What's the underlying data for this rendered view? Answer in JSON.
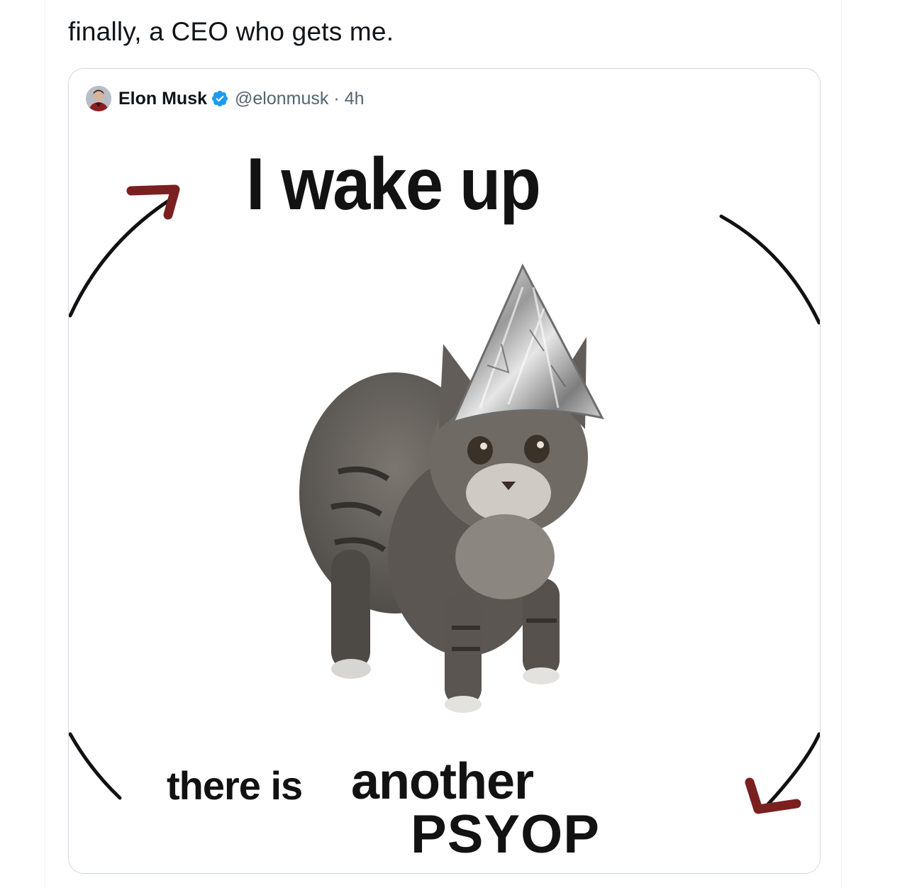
{
  "tweet": {
    "text": "finally, a CEO who gets me."
  },
  "quoted_tweet": {
    "author_name": "Elon Musk",
    "verified": true,
    "handle": "@elonmusk",
    "separator": "·",
    "time": "4h",
    "avatar_icon": "profile-photo",
    "badge_color": "#1d9bf0"
  },
  "meme": {
    "line_1": "I wake up",
    "line_2a": "there is",
    "line_2b": "another",
    "line_3": "PSYOP",
    "arrow_tip_color": "#7a2020",
    "arrow_line_color": "#111111"
  }
}
